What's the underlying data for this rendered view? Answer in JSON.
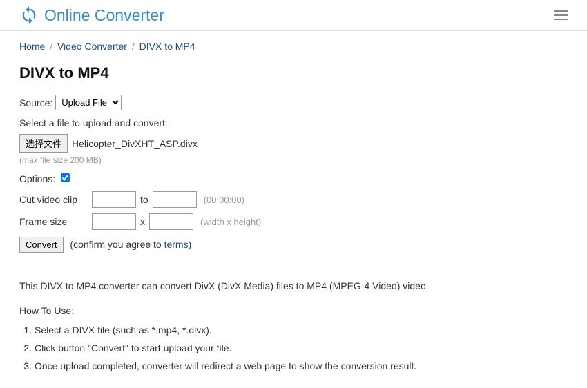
{
  "header": {
    "logo_text": "Online Converter"
  },
  "breadcrumb": {
    "home": "Home",
    "video_converter": "Video Converter",
    "current": "DIVX to MP4"
  },
  "page_title": "DIVX to MP4",
  "source": {
    "label": "Source:",
    "selected": "Upload File"
  },
  "upload": {
    "select_label": "Select a file to upload and convert:",
    "button_label": "选择文件",
    "filename": "Helicopter_DivXHT_ASP.divx",
    "max_size": "(max file size 200 MB)"
  },
  "options": {
    "label": "Options:"
  },
  "cut_clip": {
    "label": "Cut video clip",
    "to": "to",
    "hint": "(00:00:00)"
  },
  "frame_size": {
    "label": "Frame size",
    "x": "x",
    "hint": "(width x height)"
  },
  "convert": {
    "button": "Convert",
    "confirm_before": "(confirm you agree to ",
    "terms": "terms",
    "confirm_after": ")"
  },
  "description": "This DIVX to MP4 converter can convert DivX (DivX Media) files to MP4 (MPEG-4 Video) video.",
  "howto": {
    "title": "How To Use:",
    "steps": {
      "0": "Select a DIVX file (such as *.mp4, *.divx).",
      "1": "Click button \"Convert\" to start upload your file.",
      "2": "Once upload completed, converter will redirect a web page to show the conversion result."
    }
  }
}
